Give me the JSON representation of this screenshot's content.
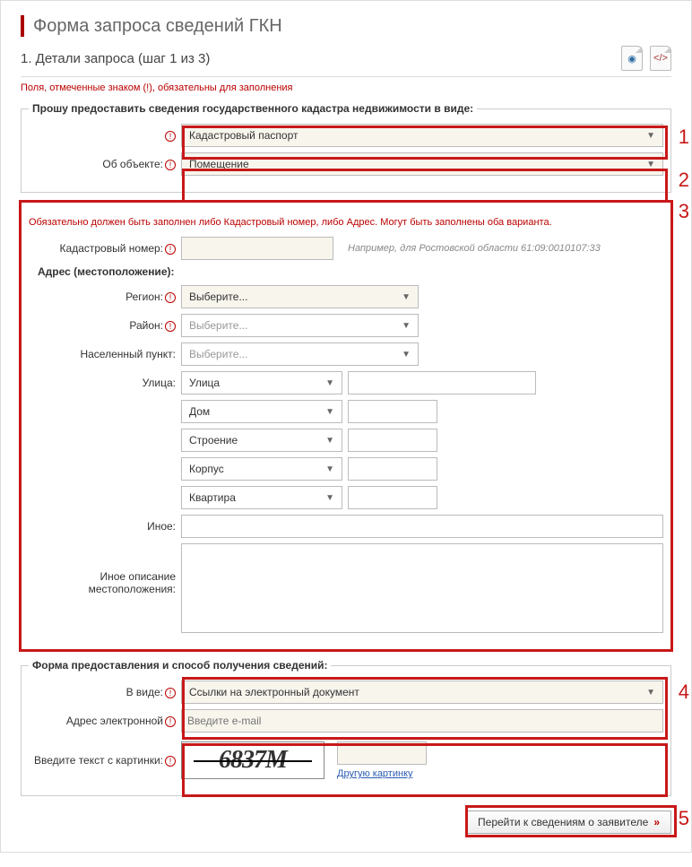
{
  "page": {
    "title": "Форма запроса сведений ГКН"
  },
  "step": {
    "title": "1. Детали запроса (шаг 1 из 3)"
  },
  "required_note": "Поля, отмеченные знаком (!), обязательны для заполнения",
  "section1": {
    "legend": "Прошу предоставить сведения государственного кадастра недвижимости в виде:",
    "doc_type": {
      "value": "Кадастровый паспорт"
    },
    "object_label": "Об объекте:",
    "object_value": "Помещение"
  },
  "section2": {
    "note": "Обязательно должен быть заполнен либо Кадастровый номер, либо Адрес. Могут быть заполнены оба варианта.",
    "cadastral_label": "Кадастровый номер:",
    "cadastral_hint": "Например, для Ростовской области 61:09:0010107:33",
    "address_header": "Адрес (местоположение):",
    "region_label": "Регион:",
    "region_value": "Выберите...",
    "district_label": "Район:",
    "district_value": "Выберите...",
    "settlement_label": "Населенный пункт:",
    "settlement_value": "Выберите...",
    "street_label": "Улица:",
    "street_type": "Улица",
    "house_type": "Дом",
    "building_type": "Строение",
    "korpus_type": "Корпус",
    "flat_type": "Квартира",
    "other_label": "Иное:",
    "other_desc_label": "Иное описание местоположения:"
  },
  "section3": {
    "legend": "Форма предоставления и способ получения сведений:",
    "format_label": "В виде:",
    "format_value": "Ссылки на электронный документ",
    "email_label": "Адрес электронной",
    "email_placeholder": "Введите e-mail",
    "captcha_label": "Введите текст с картинки:",
    "captcha_text": "6837M",
    "captcha_link": "Другую картинку"
  },
  "submit": {
    "label": "Перейти к сведениям о заявителе"
  },
  "callouts": {
    "c1": "1",
    "c2": "2",
    "c3": "3",
    "c4": "4",
    "c5": "5"
  }
}
